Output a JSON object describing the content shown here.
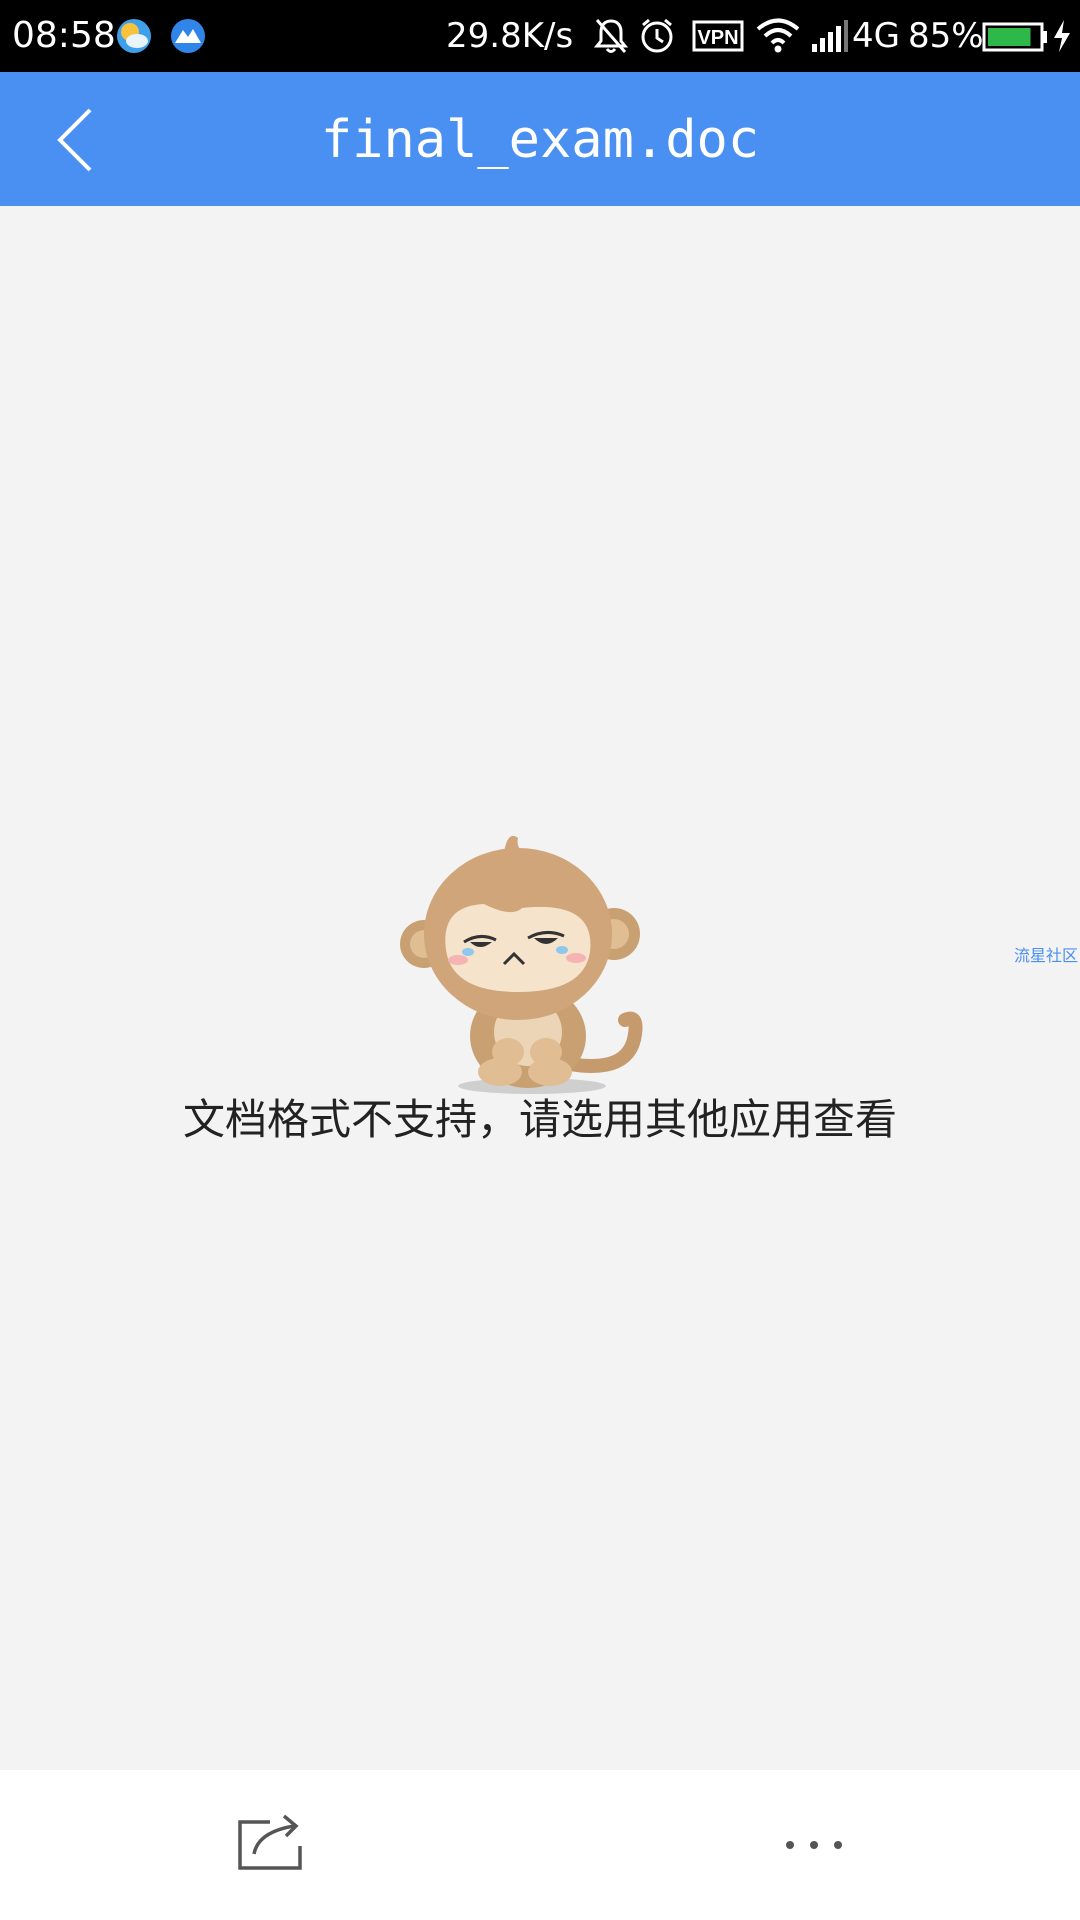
{
  "status_bar": {
    "time": "08:58",
    "network_speed": "29.8K/s",
    "vpn_label": "VPN",
    "network_type": "4G",
    "battery_percent": "85%",
    "battery_level": 0.85,
    "icons": [
      "weather-app-icon",
      "mountain-app-icon",
      "bell-off-icon",
      "alarm-icon",
      "vpn-icon",
      "wifi-icon",
      "signal-icon",
      "battery-icon",
      "charging-icon"
    ]
  },
  "header": {
    "title": "final_exam.doc",
    "back_icon": "chevron-left-icon",
    "background_color": "#4a90f2"
  },
  "main": {
    "illustration": "sad-monkey-illustration",
    "message": "文档格式不支持，请选用其他应用查看",
    "watermark": "流星社区"
  },
  "bottom_bar": {
    "share_icon": "share-icon",
    "more_icon": "more-dots-icon"
  }
}
